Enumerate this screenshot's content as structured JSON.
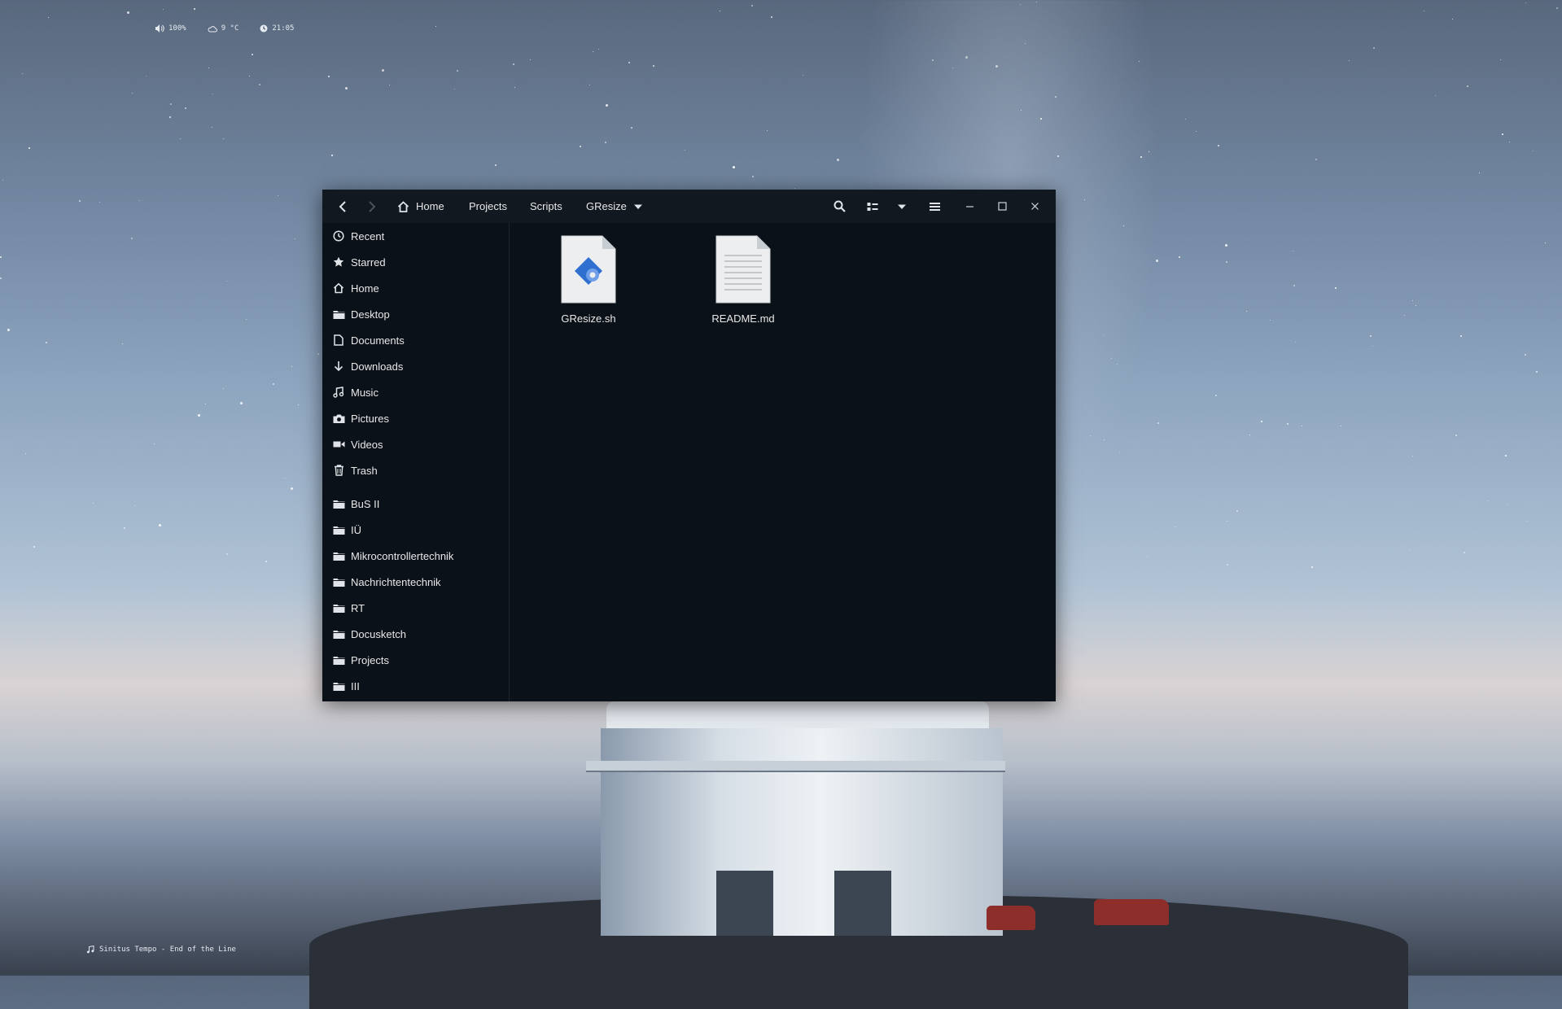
{
  "topbar": {
    "volume": "100%",
    "weather": "9 °C",
    "clock": "21:05"
  },
  "now_playing": "Sinitus Tempo - End of the Line",
  "file_manager": {
    "breadcrumbs": [
      "Home",
      "Projects",
      "Scripts",
      "GResize"
    ],
    "icons": {
      "back": "chevron-left-icon",
      "forward": "chevron-right-icon",
      "search": "search-icon",
      "view": "list-view-icon",
      "sort": "chevron-down-icon",
      "menu": "hamburger-icon",
      "minimize": "minimize-icon",
      "maximize": "maximize-icon",
      "close": "close-icon"
    },
    "sidebar": {
      "places": [
        {
          "label": "Recent",
          "icon": "clock-icon"
        },
        {
          "label": "Starred",
          "icon": "star-icon"
        },
        {
          "label": "Home",
          "icon": "home-icon"
        },
        {
          "label": "Desktop",
          "icon": "folder-icon"
        },
        {
          "label": "Documents",
          "icon": "document-icon"
        },
        {
          "label": "Downloads",
          "icon": "download-icon"
        },
        {
          "label": "Music",
          "icon": "music-icon"
        },
        {
          "label": "Pictures",
          "icon": "camera-icon"
        },
        {
          "label": "Videos",
          "icon": "video-icon"
        },
        {
          "label": "Trash",
          "icon": "trash-icon"
        }
      ],
      "bookmarks": [
        {
          "label": "BuS II",
          "icon": "folder-icon"
        },
        {
          "label": "IÜ",
          "icon": "folder-icon"
        },
        {
          "label": "Mikrocontrollertechnik",
          "icon": "folder-icon"
        },
        {
          "label": "Nachrichtentechnik",
          "icon": "folder-icon"
        },
        {
          "label": "RT",
          "icon": "folder-icon"
        },
        {
          "label": "Docusketch",
          "icon": "folder-icon"
        },
        {
          "label": "Projects",
          "icon": "folder-icon"
        },
        {
          "label": "III",
          "icon": "folder-icon"
        }
      ]
    },
    "files": [
      {
        "name": "GResize.sh",
        "icon": "script-file-icon"
      },
      {
        "name": "README.md",
        "icon": "text-file-icon"
      }
    ]
  }
}
